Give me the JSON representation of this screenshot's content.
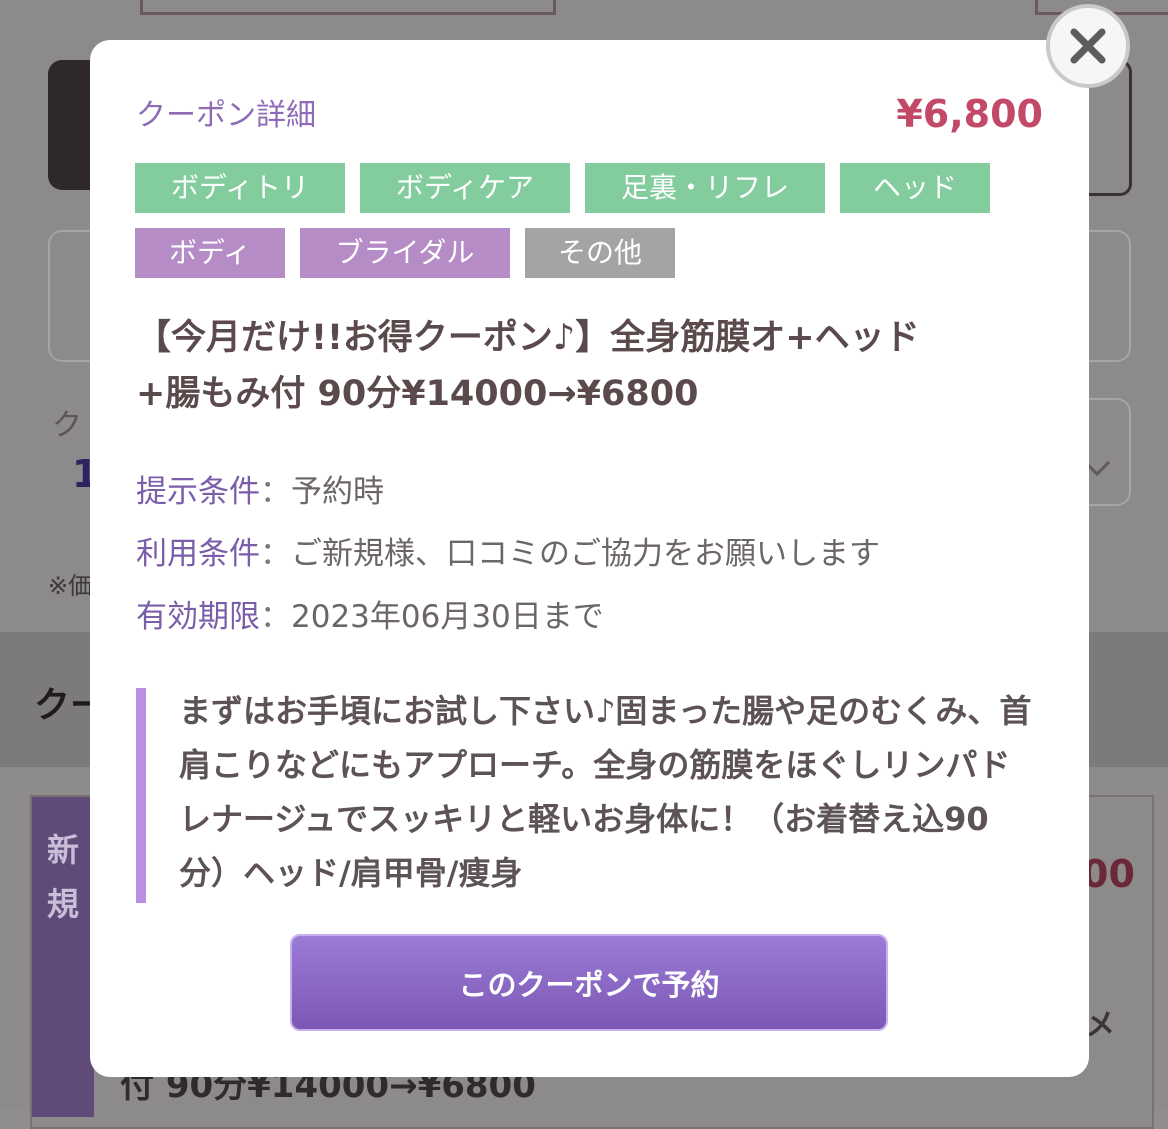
{
  "background": {
    "left_label_1": "ク",
    "left_label_2": "1",
    "left_note": "※価",
    "band_label": "クー",
    "new_label": "新\n規",
    "price_partial": "00",
    "bottom_text": "付 90分¥14000→¥6800",
    "right_char": "メ"
  },
  "modal": {
    "title": "クーポン詳細",
    "price": "¥6,800",
    "close_icon": "close-icon",
    "tags": [
      {
        "label": "ボディトリ",
        "color": "green"
      },
      {
        "label": "ボディケア",
        "color": "green"
      },
      {
        "label": "足裏・リフレ",
        "color": "green"
      },
      {
        "label": "ヘッド",
        "color": "green"
      },
      {
        "label": "ボディ",
        "color": "purple"
      },
      {
        "label": "ブライダル",
        "color": "purple"
      },
      {
        "label": "その他",
        "color": "gray"
      }
    ],
    "coupon_name_line1": "【今月だけ!!お得クーポン♪】全身筋膜オ+ヘッド",
    "coupon_name_line2": "+腸もみ付 90分¥14000→¥6800",
    "conditions": [
      {
        "label": "提示条件",
        "sep": "：",
        "value": "予約時"
      },
      {
        "label": "利用条件",
        "sep": "：",
        "value": "ご新規様、口コミのご協力をお願いします"
      },
      {
        "label": "有効期限",
        "sep": "：",
        "value": "2023年06月30日まで"
      }
    ],
    "description": "まずはお手頃にお試し下さい♪固まった腸や足のむくみ、首肩こりなどにもアプローチ。全身の筋膜をほぐしリンパドレナージュでスッキリと軽いお身体に！（お着替え込90分）ヘッド/肩甲骨/痩身",
    "reserve_button": "このクーポンで予約"
  },
  "colors": {
    "accent_purple": "#8d6bb7",
    "price_red": "#c24a68",
    "tag_green": "#82cc9d",
    "tag_purple": "#b58cc6",
    "tag_gray": "#a4a4a4"
  }
}
